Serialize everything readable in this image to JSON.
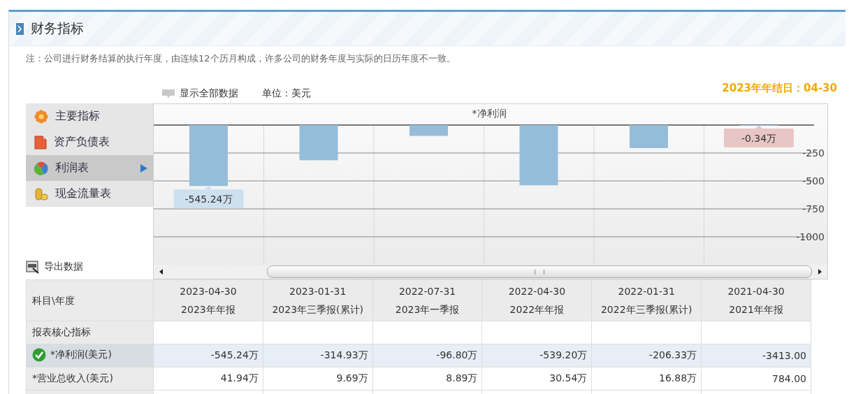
{
  "section": {
    "title": "财务指标"
  },
  "note": "注：公司进行财务结算的执行年度，由连续12个历月构成，许多公司的财务年度与实际的日历年度不一致。",
  "toolbar": {
    "show_all": "显示全部数据",
    "unit": "单位：美元"
  },
  "fiscal_year_end": "2023年年结日：04-30",
  "sidebar": {
    "items": [
      {
        "label": "主要指标",
        "kind": "flower",
        "selected": false
      },
      {
        "label": "资产负债表",
        "kind": "document",
        "selected": false
      },
      {
        "label": "利润表",
        "kind": "ball",
        "selected": true
      },
      {
        "label": "现金流量表",
        "kind": "coins",
        "selected": false
      }
    ],
    "export": "导出数据"
  },
  "chart": {
    "chart_data": {
      "type": "bar",
      "title": "*净利润",
      "values": [
        -545,
        -315,
        -97,
        -539,
        -206,
        0
      ],
      "ylim": [
        -1250,
        0
      ],
      "yticks": [
        -250,
        -500,
        -750,
        -1000
      ],
      "grid": true,
      "annotations": [
        {
          "y": -545,
          "text": "-545.24万"
        },
        {
          "y": 0,
          "text": "-0.34万"
        }
      ]
    }
  },
  "table": {
    "corner": "科目\\年度",
    "columns": [
      {
        "date": "2023-04-30",
        "period": "2023年年报"
      },
      {
        "date": "2023-01-31",
        "period": "2023年三季报(累计)"
      },
      {
        "date": "2022-07-31",
        "period": "2023年一季报"
      },
      {
        "date": "2022-04-30",
        "period": "2022年年报"
      },
      {
        "date": "2022-01-31",
        "period": "2022年三季报(累计)"
      },
      {
        "date": "2021-04-30",
        "period": "2021年年报"
      }
    ],
    "rows": [
      {
        "label": "报表核心指标",
        "kind": "group"
      },
      {
        "label": "*净利润(美元)",
        "kind": "value",
        "selected": true,
        "values": [
          "-545.24万",
          "-314.93万",
          "-96.80万",
          "-539.20万",
          "-206.33万",
          "-3413.00"
        ]
      },
      {
        "label": "*营业总收入(美元)",
        "kind": "value",
        "selected": false,
        "values": [
          "41.94万",
          "9.69万",
          "8.89万",
          "30.54万",
          "16.88万",
          "784.00"
        ]
      }
    ]
  }
}
